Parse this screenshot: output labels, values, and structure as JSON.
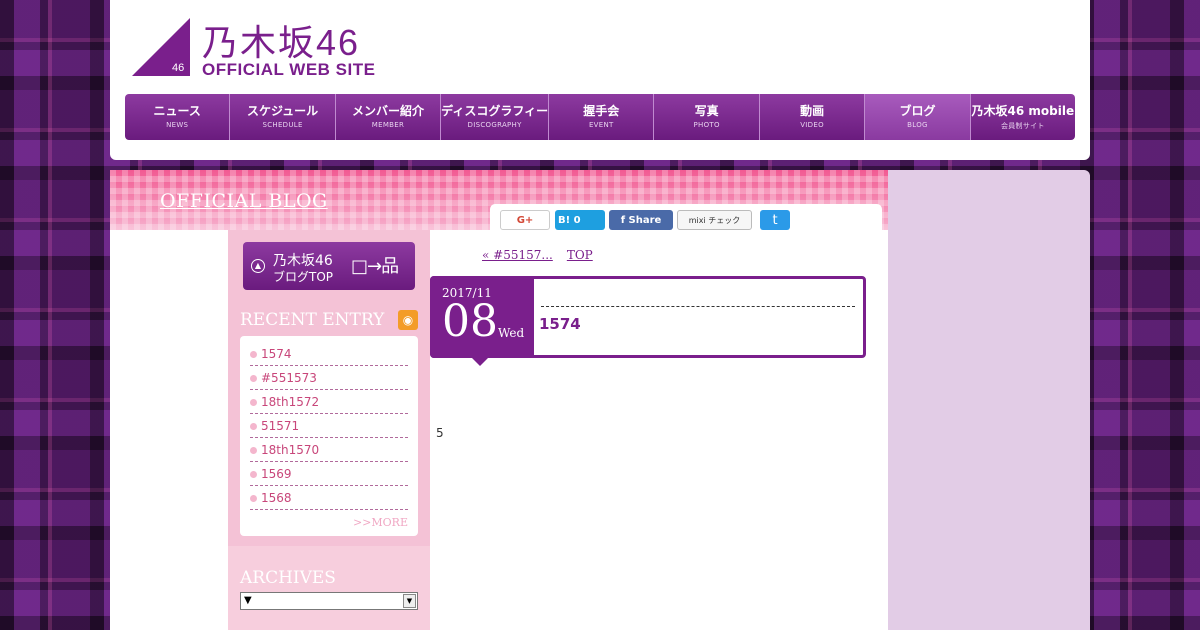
{
  "logo": {
    "jp": "乃木坂46",
    "en": "OFFICIAL WEB SITE",
    "mark_num": "46"
  },
  "nav": [
    {
      "jp": "ニュース",
      "en": "NEWS"
    },
    {
      "jp": "スケジュール",
      "en": "SCHEDULE"
    },
    {
      "jp": "メンバー紹介",
      "en": "MEMBER"
    },
    {
      "jp": "ディスコグラフィー",
      "en": "DISCOGRAPHY"
    },
    {
      "jp": "握手会",
      "en": "EVENT"
    },
    {
      "jp": "写真",
      "en": "PHOTO"
    },
    {
      "jp": "動画",
      "en": "VIDEO"
    },
    {
      "jp": "ブログ",
      "en": "BLOG"
    },
    {
      "jp": "乃木坂46 mobile",
      "en": "会員制サイト"
    }
  ],
  "blog": {
    "title": "OFFICIAL BLOG"
  },
  "share": {
    "gplus": "G+",
    "hatena": "B! 0",
    "facebook": "f  Share",
    "mixi": "mixi チェック",
    "twitter": "t"
  },
  "sidebar": {
    "blogtop_line1": "乃木坂46",
    "blogtop_line2": "ブログTOP",
    "recent_title": "RECENT ENTRY",
    "recent": [
      "1574",
      "#551573",
      "18th1572",
      "51571",
      "18th1570",
      "1569",
      "1568"
    ],
    "more": ">>MORE",
    "archives_title": "ARCHIVES",
    "archives_selected": "▼"
  },
  "pager": {
    "prev": "« #55157...",
    "top": "TOP"
  },
  "entry": {
    "year_month": "2017/11",
    "day": "08",
    "weekday": "Wed",
    "title": "1574",
    "body": "5"
  }
}
